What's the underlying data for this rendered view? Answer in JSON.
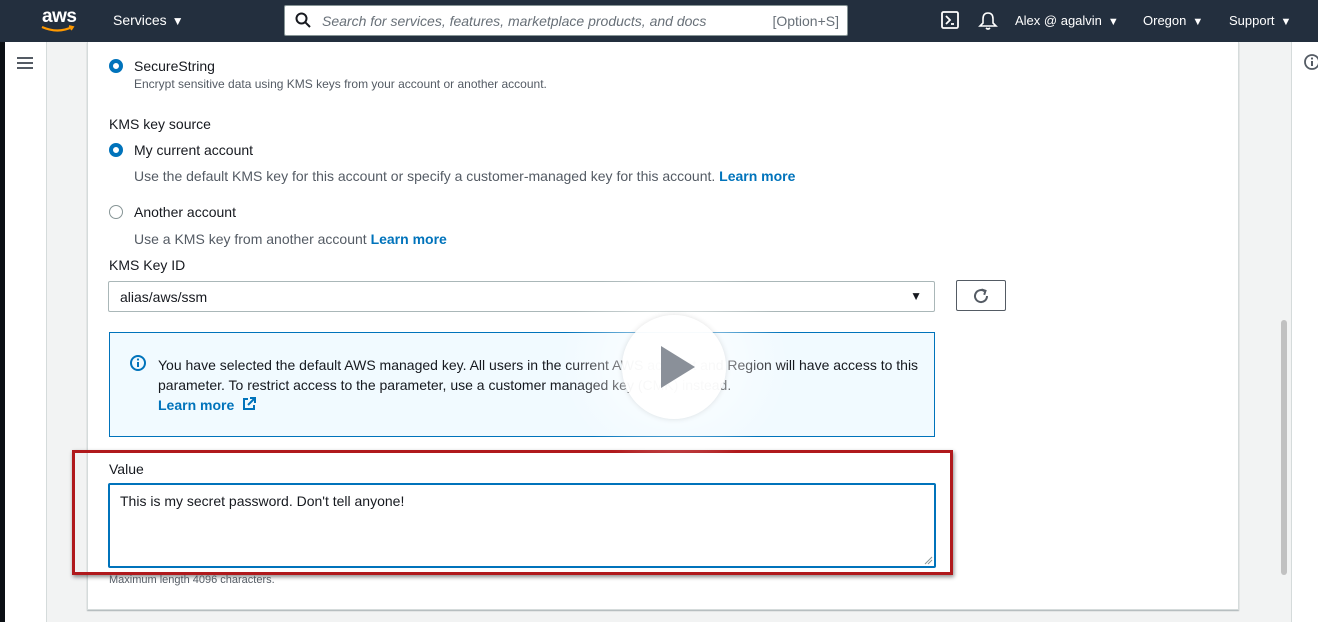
{
  "nav": {
    "logo": "aws",
    "services": "Services",
    "search_placeholder": "Search for services, features, marketplace products, and docs",
    "search_shortcut": "[Option+S]",
    "user": "Alex @ agalvin",
    "region": "Oregon",
    "support": "Support"
  },
  "form": {
    "securestring_label": "SecureString",
    "securestring_desc": "Encrypt sensitive data using KMS keys from your account or another account.",
    "kms_key_source_label": "KMS key source",
    "my_account_label": "My current account",
    "my_account_desc": "Use the default KMS key for this account or specify a customer-managed key for this account.",
    "my_account_link": "Learn more",
    "another_account_label": "Another account",
    "another_account_desc": "Use a KMS key from another account",
    "another_account_link": "Learn more",
    "kms_key_id_label": "KMS Key ID",
    "kms_key_id_value": "alias/aws/ssm",
    "info_text": "You have selected the default AWS managed key. All users in the current AWS account and Region will have access to this parameter. To restrict access to the parameter, use a customer managed key (CMK) instead.",
    "info_link": "Learn more",
    "value_label": "Value",
    "value_text": "This is my secret password. Don't tell anyone!",
    "value_hint": "Maximum length 4096 characters."
  },
  "colors": {
    "nav_bg": "#232f3e",
    "accent": "#0073bb",
    "highlight": "#b0191c",
    "info_bg": "#f1faff"
  },
  "icons": [
    "search-icon",
    "cloudshell-icon",
    "bell-icon",
    "hamburger-icon",
    "info-icon",
    "refresh-icon",
    "external-link-icon",
    "play-icon"
  ]
}
